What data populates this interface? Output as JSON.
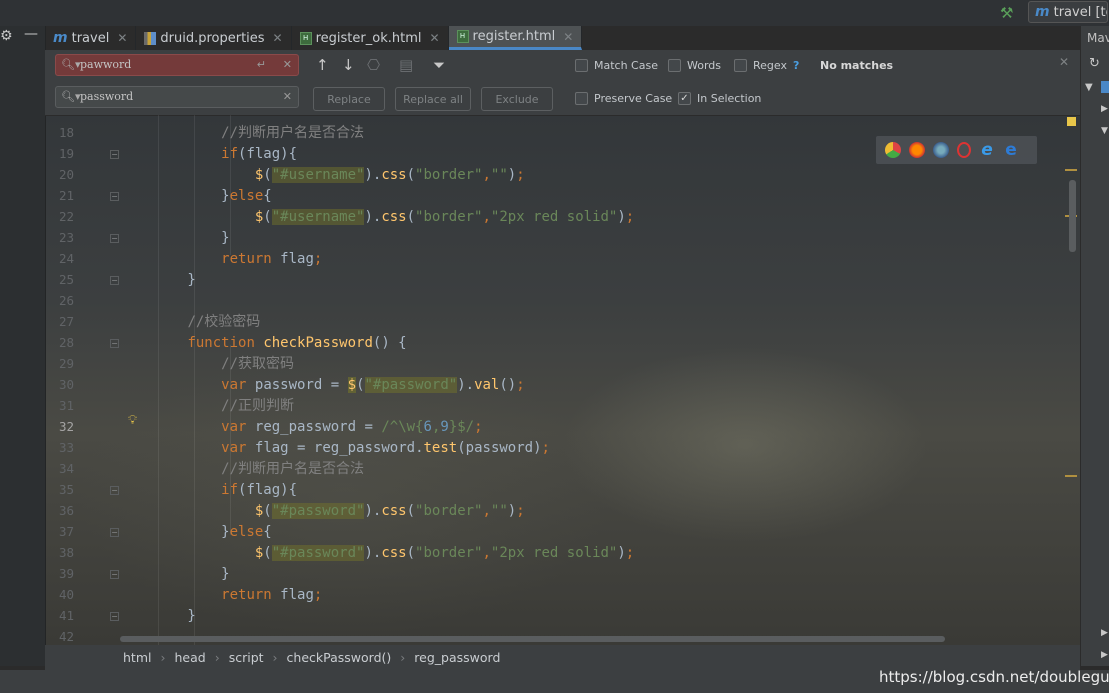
{
  "tabs": [
    {
      "label": "travel",
      "icon": "maven-icon",
      "active": false
    },
    {
      "label": "druid.properties",
      "icon": "properties-file-icon",
      "active": false
    },
    {
      "label": "register_ok.html",
      "icon": "html-file-icon",
      "active": false
    },
    {
      "label": "register.html",
      "icon": "html-file-icon",
      "active": true
    }
  ],
  "project_button": {
    "label": "travel [tou"
  },
  "find": {
    "search_value": "pawword",
    "replace_value": "password",
    "status": "No matches",
    "options": {
      "match_case": {
        "label": "Match Case",
        "checked": false
      },
      "words": {
        "label": "Words",
        "checked": false
      },
      "regex": {
        "label": "Regex",
        "checked": false,
        "help": "?"
      },
      "preserve_case": {
        "label": "Preserve Case",
        "checked": false
      },
      "in_selection": {
        "label": "In Selection",
        "checked": true
      }
    },
    "buttons": {
      "replace": "Replace",
      "replace_all": "Replace all",
      "exclude": "Exclude"
    }
  },
  "editor": {
    "current_line": 32,
    "lines": [
      {
        "n": 18,
        "text": "            //判断用户名是否合法"
      },
      {
        "n": 19,
        "text": "            if(flag){"
      },
      {
        "n": 20,
        "text": "                $(\"#username\").css(\"border\",\"\");"
      },
      {
        "n": 21,
        "text": "            }else{"
      },
      {
        "n": 22,
        "text": "                $(\"#username\").css(\"border\",\"2px red solid\");"
      },
      {
        "n": 23,
        "text": "            }"
      },
      {
        "n": 24,
        "text": "            return flag;"
      },
      {
        "n": 25,
        "text": "        }"
      },
      {
        "n": 26,
        "text": ""
      },
      {
        "n": 27,
        "text": "        //校验密码"
      },
      {
        "n": 28,
        "text": "        function checkPassword() {"
      },
      {
        "n": 29,
        "text": "            //获取密码"
      },
      {
        "n": 30,
        "text": "            var password = $(\"#password\").val();"
      },
      {
        "n": 31,
        "text": "            //正则判断"
      },
      {
        "n": 32,
        "text": "            var reg_password = /^\\w{6,9}$/;"
      },
      {
        "n": 33,
        "text": "            var flag = reg_password.test(password);"
      },
      {
        "n": 34,
        "text": "            //判断用户名是否合法"
      },
      {
        "n": 35,
        "text": "            if(flag){"
      },
      {
        "n": 36,
        "text": "                $(\"#password\").css(\"border\",\"\");"
      },
      {
        "n": 37,
        "text": "            }else{"
      },
      {
        "n": 38,
        "text": "                $(\"#password\").css(\"border\",\"2px red solid\");"
      },
      {
        "n": 39,
        "text": "            }"
      },
      {
        "n": 40,
        "text": "            return flag;"
      },
      {
        "n": 41,
        "text": "        }"
      },
      {
        "n": 42,
        "text": ""
      }
    ]
  },
  "browsers": [
    "chrome-icon",
    "firefox-icon",
    "safari-icon",
    "opera-icon",
    "ie-icon",
    "edge-icon"
  ],
  "breadcrumb": [
    "html",
    "head",
    "script",
    "checkPassword()",
    "reg_password"
  ],
  "right_panel": {
    "title": "Mav"
  },
  "watermark": "https://blog.csdn.net/doubleguy"
}
